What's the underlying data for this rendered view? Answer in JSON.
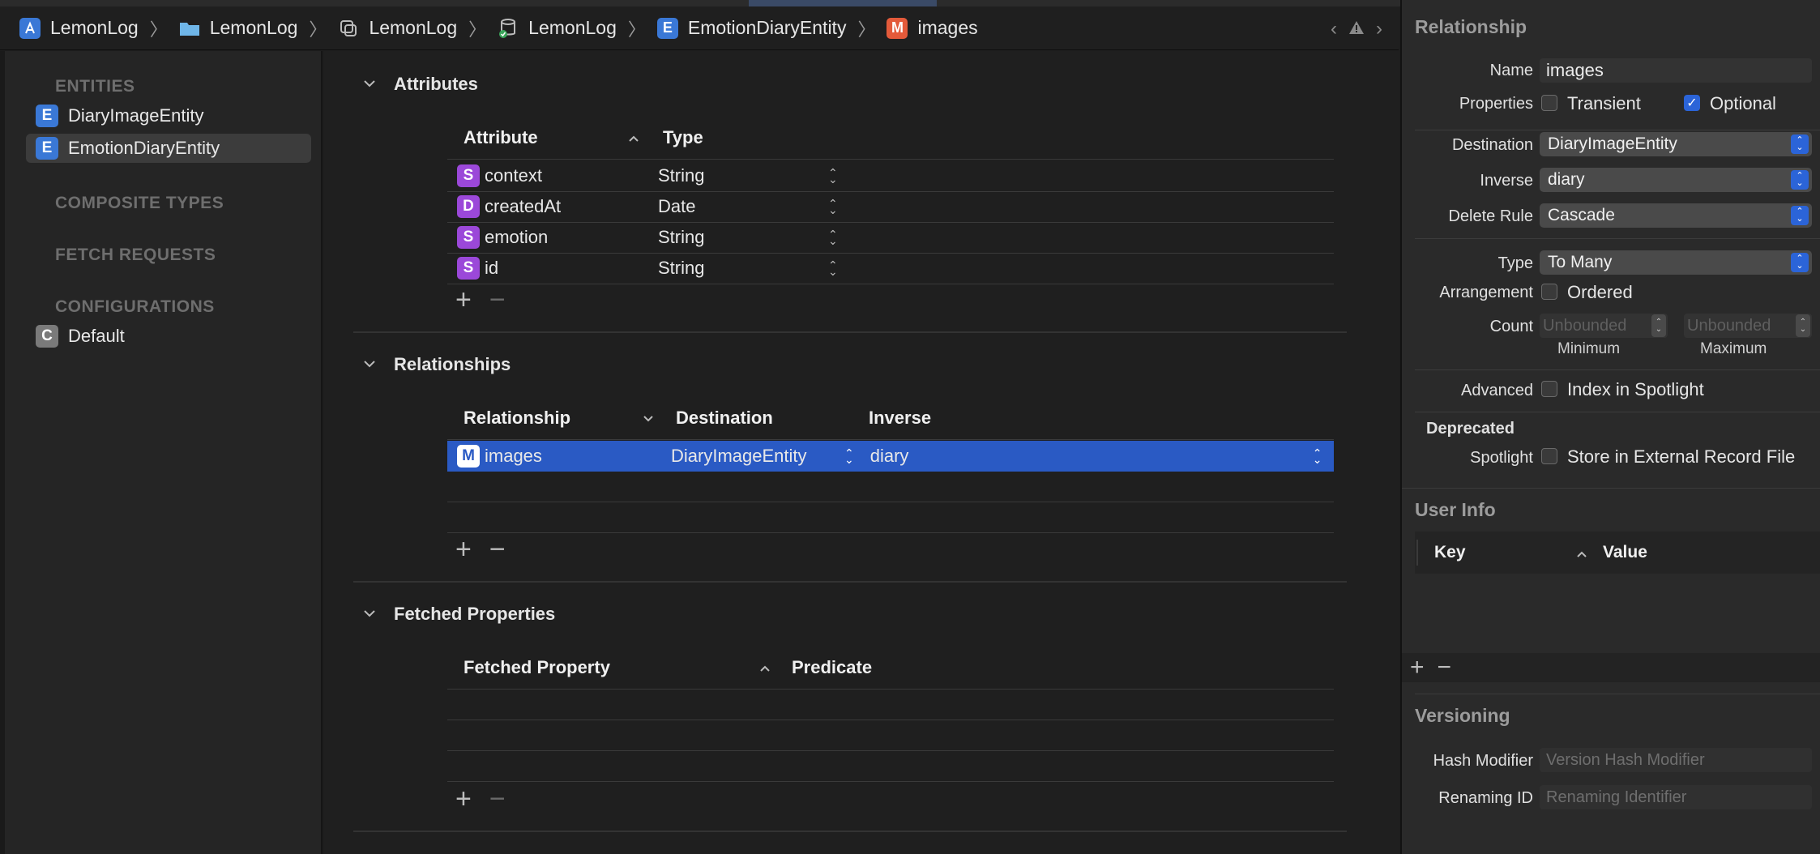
{
  "breadcrumb": {
    "items": [
      {
        "label": "LemonLog",
        "icon": "app-icon"
      },
      {
        "label": "LemonLog",
        "icon": "folder-icon"
      },
      {
        "label": "LemonLog",
        "icon": "group-icon"
      },
      {
        "label": "LemonLog",
        "icon": "datamodel-icon"
      },
      {
        "label": "EmotionDiaryEntity",
        "icon": "entity-icon",
        "badge": "E"
      },
      {
        "label": "images",
        "icon": "relationship-icon",
        "badge": "M"
      }
    ],
    "separator": "〉"
  },
  "sidebar": {
    "entities_header": "ENTITIES",
    "entities": [
      {
        "badge": "E",
        "label": "DiaryImageEntity"
      },
      {
        "badge": "E",
        "label": "EmotionDiaryEntity"
      }
    ],
    "composite_header": "COMPOSITE TYPES",
    "fetch_header": "FETCH REQUESTS",
    "config_header": "CONFIGURATIONS",
    "configurations": [
      {
        "badge": "C",
        "label": "Default"
      }
    ]
  },
  "attributes": {
    "title": "Attributes",
    "col_attribute": "Attribute",
    "col_type": "Type",
    "rows": [
      {
        "badge": "S",
        "name": "context",
        "type": "String"
      },
      {
        "badge": "D",
        "name": "createdAt",
        "type": "Date"
      },
      {
        "badge": "S",
        "name": "emotion",
        "type": "String"
      },
      {
        "badge": "S",
        "name": "id",
        "type": "String"
      }
    ]
  },
  "relationships": {
    "title": "Relationships",
    "col_relationship": "Relationship",
    "col_destination": "Destination",
    "col_inverse": "Inverse",
    "rows": [
      {
        "badge": "M",
        "name": "images",
        "destination": "DiaryImageEntity",
        "inverse": "diary"
      }
    ]
  },
  "fetched": {
    "title": "Fetched Properties",
    "col_property": "Fetched Property",
    "col_predicate": "Predicate"
  },
  "inspector": {
    "relationship_title": "Relationship",
    "name_label": "Name",
    "name_value": "images",
    "properties_label": "Properties",
    "transient_label": "Transient",
    "optional_label": "Optional",
    "destination_label": "Destination",
    "destination_value": "DiaryImageEntity",
    "inverse_label": "Inverse",
    "inverse_value": "diary",
    "delete_rule_label": "Delete Rule",
    "delete_rule_value": "Cascade",
    "type_label": "Type",
    "type_value": "To Many",
    "arrangement_label": "Arrangement",
    "ordered_label": "Ordered",
    "count_label": "Count",
    "min_placeholder": "Unbounded",
    "max_placeholder": "Unbounded",
    "minimum_label": "Minimum",
    "maximum_label": "Maximum",
    "advanced_label": "Advanced",
    "index_spotlight_label": "Index in Spotlight",
    "deprecated_label": "Deprecated",
    "spotlight_label": "Spotlight",
    "external_record_label": "Store in External Record File",
    "user_info_title": "User Info",
    "key_col": "Key",
    "value_col": "Value",
    "versioning_title": "Versioning",
    "hash_label": "Hash Modifier",
    "hash_placeholder": "Version Hash Modifier",
    "renaming_label": "Renaming ID",
    "renaming_placeholder": "Renaming Identifier"
  },
  "colors": {
    "selection": "#2a5ac4",
    "accent": "#2b64d8",
    "entity_badge": "#3a78d6",
    "attribute_badge": "#9b48d9",
    "relationship_badge": "#e35a3a"
  }
}
